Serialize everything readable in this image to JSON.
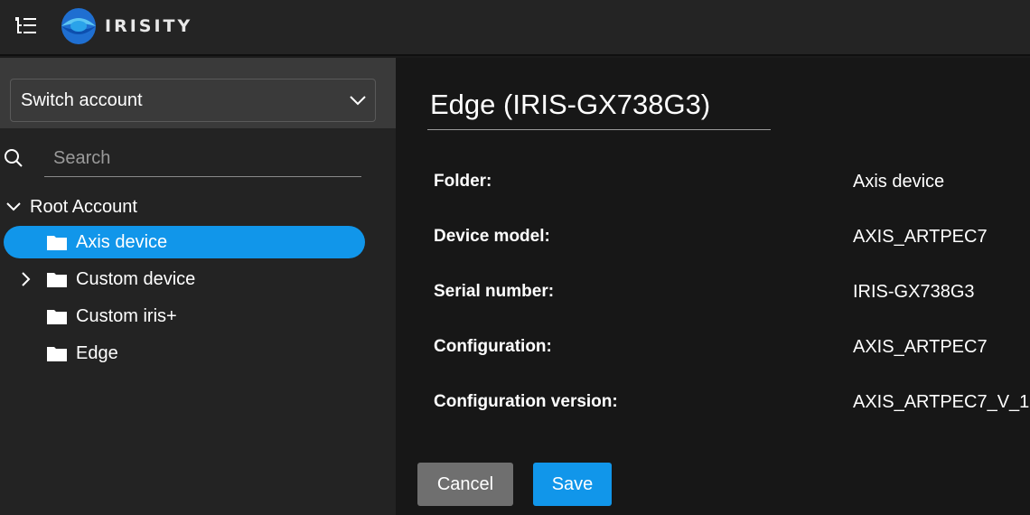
{
  "header": {
    "brand": "IRISITY",
    "menu_icon": "tree-menu-icon",
    "logo_icon": "irisity-logo-icon"
  },
  "sidebar": {
    "switch_account": {
      "label": "Switch account"
    },
    "search": {
      "placeholder": "Search",
      "value": ""
    },
    "tree": {
      "root": {
        "label": "Root Account",
        "expanded": true
      },
      "items": [
        {
          "label": "Axis device",
          "selected": true,
          "has_children": false
        },
        {
          "label": "Custom device",
          "selected": false,
          "has_children": true
        },
        {
          "label": "Custom iris+",
          "selected": false,
          "has_children": false
        },
        {
          "label": "Edge",
          "selected": false,
          "has_children": false
        }
      ]
    }
  },
  "main": {
    "title": "Edge (IRIS-GX738G3)",
    "fields": [
      {
        "key": "Folder:",
        "value": "Axis device"
      },
      {
        "key": "Device model:",
        "value": "AXIS_ARTPEC7"
      },
      {
        "key": "Serial number:",
        "value": "IRIS-GX738G3"
      },
      {
        "key": "Configuration:",
        "value": "AXIS_ARTPEC7"
      },
      {
        "key": "Configuration version:",
        "value": "AXIS_ARTPEC7_V_1"
      }
    ],
    "actions": {
      "cancel_label": "Cancel",
      "save_label": "Save"
    }
  },
  "colors": {
    "accent": "#1196ea",
    "topbar": "#242424",
    "sidebar": "#232323",
    "main": "#171717",
    "cancel": "#6f6f6f"
  }
}
